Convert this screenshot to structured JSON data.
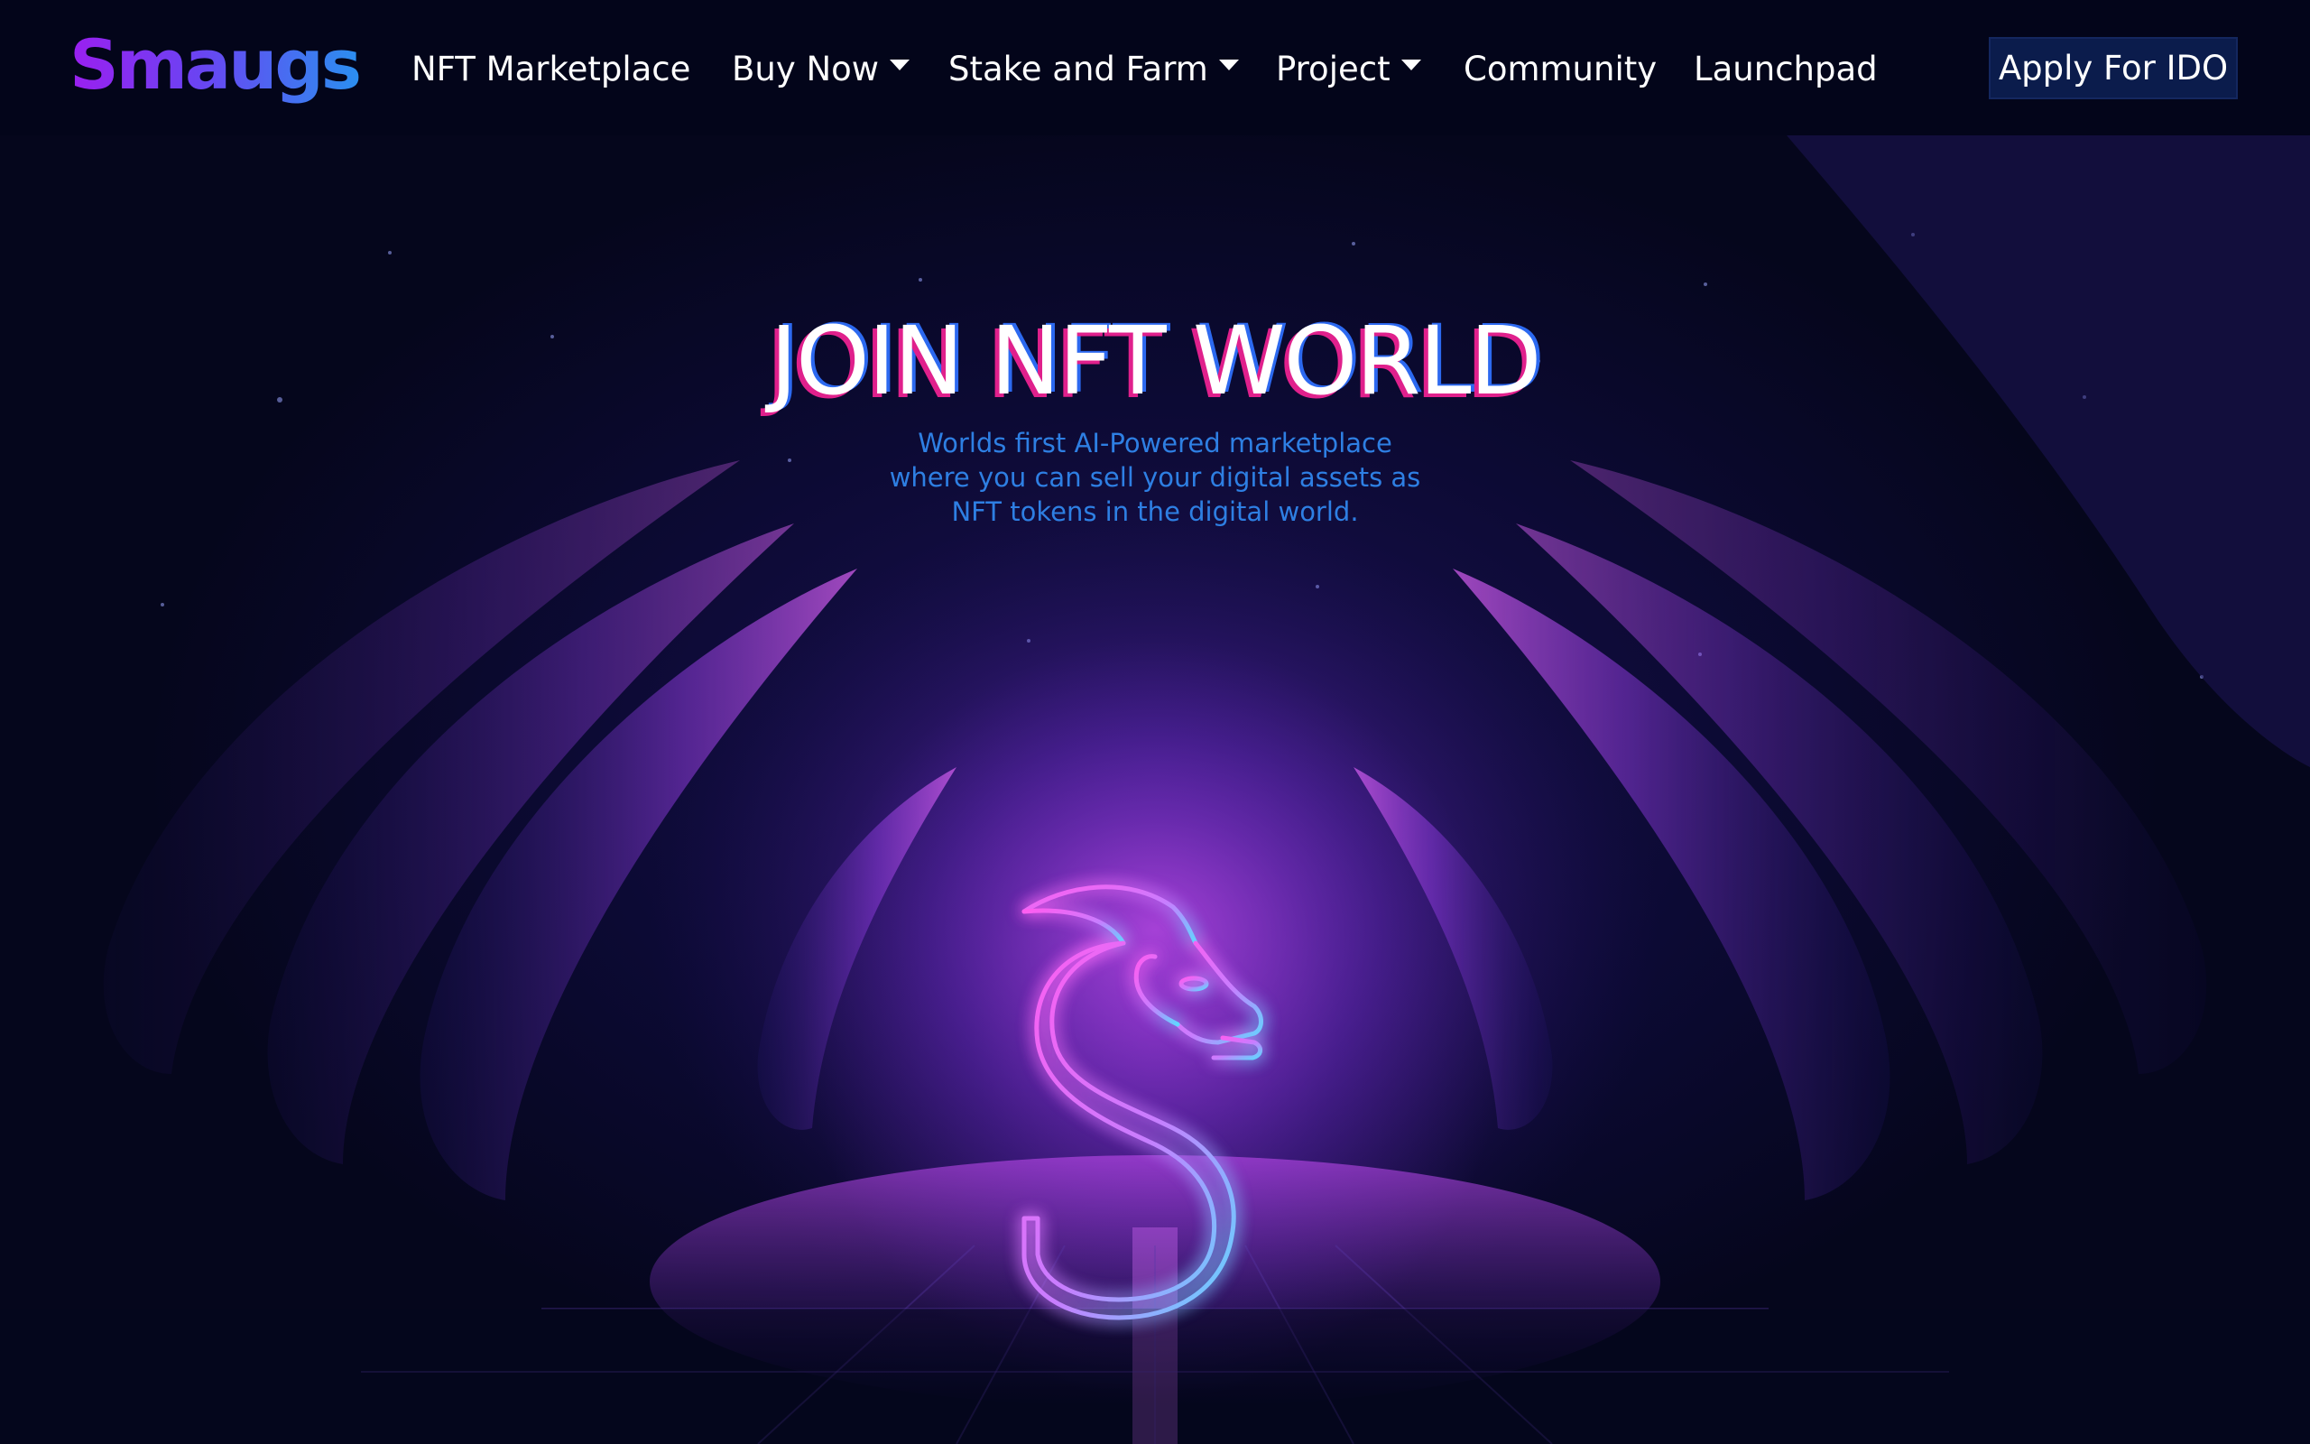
{
  "brand": {
    "logo_text": "Smaugs"
  },
  "nav": {
    "items": [
      {
        "label": "NFT Marketplace",
        "has_dropdown": false
      },
      {
        "label": "Buy Now",
        "has_dropdown": true
      },
      {
        "label": "Stake and Farm",
        "has_dropdown": true
      },
      {
        "label": "Project",
        "has_dropdown": true
      },
      {
        "label": "Community",
        "has_dropdown": false
      },
      {
        "label": "Launchpad",
        "has_dropdown": false
      }
    ],
    "cta_label": "Apply For IDO"
  },
  "hero": {
    "title": "JOIN NFT WORLD",
    "subtitle_lines": [
      "Worlds first AI-Powered marketplace",
      "where you can sell your digital assets as",
      "NFT tokens in the digital world."
    ],
    "emblem_icon": "neon-dragon-s-icon"
  },
  "colors": {
    "background": "#05061c",
    "navbar": "#03051a",
    "cta_bg": "#0b1c4c",
    "subtitle": "#2e7fe3",
    "neon_pink": "#ff5cf0",
    "neon_cyan": "#5fd8ff",
    "title_shadow_pink": "#e0208c",
    "title_shadow_blue": "#2c69f0"
  }
}
